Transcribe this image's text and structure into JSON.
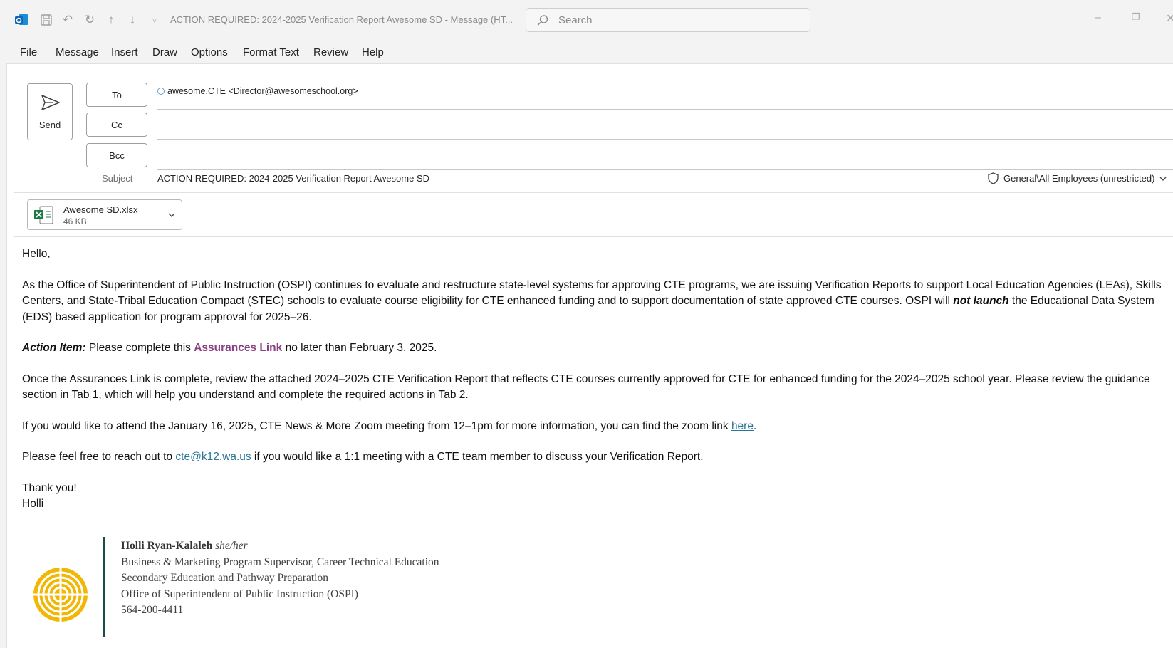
{
  "window": {
    "title": "ACTION REQUIRED: 2024-2025 Verification Report Awesome SD  -  Message (HT...",
    "search_placeholder": "Search",
    "app_icon": "outlook-icon",
    "quick_access_icons": [
      "save-icon",
      "undo-icon",
      "redo-icon",
      "up-arrow-icon",
      "down-arrow-icon",
      "customize-dropdown-icon"
    ]
  },
  "menu": {
    "items": [
      "File",
      "Message",
      "Insert",
      "Draw",
      "Options",
      "Format Text",
      "Review",
      "Help"
    ]
  },
  "compose": {
    "send_label": "Send",
    "to_label": "To",
    "cc_label": "Cc",
    "bcc_label": "Bcc",
    "to_recipient": "awesome.CTE <Director@awesomeschool.org>",
    "cc_value": "",
    "bcc_value": "",
    "subject_label": "Subject",
    "subject_value": "ACTION REQUIRED: 2024-2025 Verification Report Awesome SD",
    "sensitivity": "General\\All Employees (unrestricted)"
  },
  "attachment": {
    "name": "Awesome SD.xlsx",
    "size": "46 KB",
    "icon": "excel-icon"
  },
  "body": {
    "greeting": "Hello,",
    "p1_text_a": "As the Office of Superintendent of Public Instruction (OSPI) continues to evaluate and restructure state-level systems for approving CTE programs, we are issuing Verification Reports to support Local Education Agencies (LEAs), Skills Centers, and State-Tribal Education Compact (STEC) schools to evaluate course eligibility for CTE enhanced funding and to support documentation of state approved CTE courses. OSPI will ",
    "p1_emphasis": "not launch",
    "p1_text_b": " the Educational Data System (EDS) based application for program approval for 2025–26.",
    "action_label": "Action Item:",
    "action_text_a": " Please complete this ",
    "action_link": "Assurances Link",
    "action_text_b": " no later than February 3, 2025.",
    "p3": "Once the Assurances Link is complete, review the attached 2024–2025 CTE Verification Report that reflects CTE courses currently approved for CTE for enhanced funding for the 2024–2025 school year. Please review the guidance section in Tab 1, which will help you understand and complete the required actions in Tab 2.",
    "p4_text_a": "If you would like to attend the January 16, 2025, CTE News & More Zoom meeting from 12–1pm for more information, you can find the zoom link ",
    "p4_link": "here",
    "p4_text_b": ".",
    "p5_text_a": "Please feel free to reach out to ",
    "p5_link": "cte@k12.wa.us",
    "p5_text_b": " if you would like a 1:1 meeting with a CTE team member to discuss your Verification Report.",
    "closing": "Thank you!",
    "sender_first": "Holli"
  },
  "signature": {
    "name": "Holli Ryan-Kalaleh",
    "pronouns": "she/her",
    "title": "Business & Marketing Program Supervisor, Career Technical Education",
    "department": "Secondary Education and Pathway Preparation",
    "office": "Office of Superintendent of Public Instruction (OSPI)",
    "phone": "564-200-4411",
    "logo": "ospi-logo"
  },
  "colors": {
    "link_purple": "#8c3f83",
    "link_teal": "#2b7596",
    "signature_bar": "#1b4d48",
    "logo_gold": "#f2b705"
  }
}
